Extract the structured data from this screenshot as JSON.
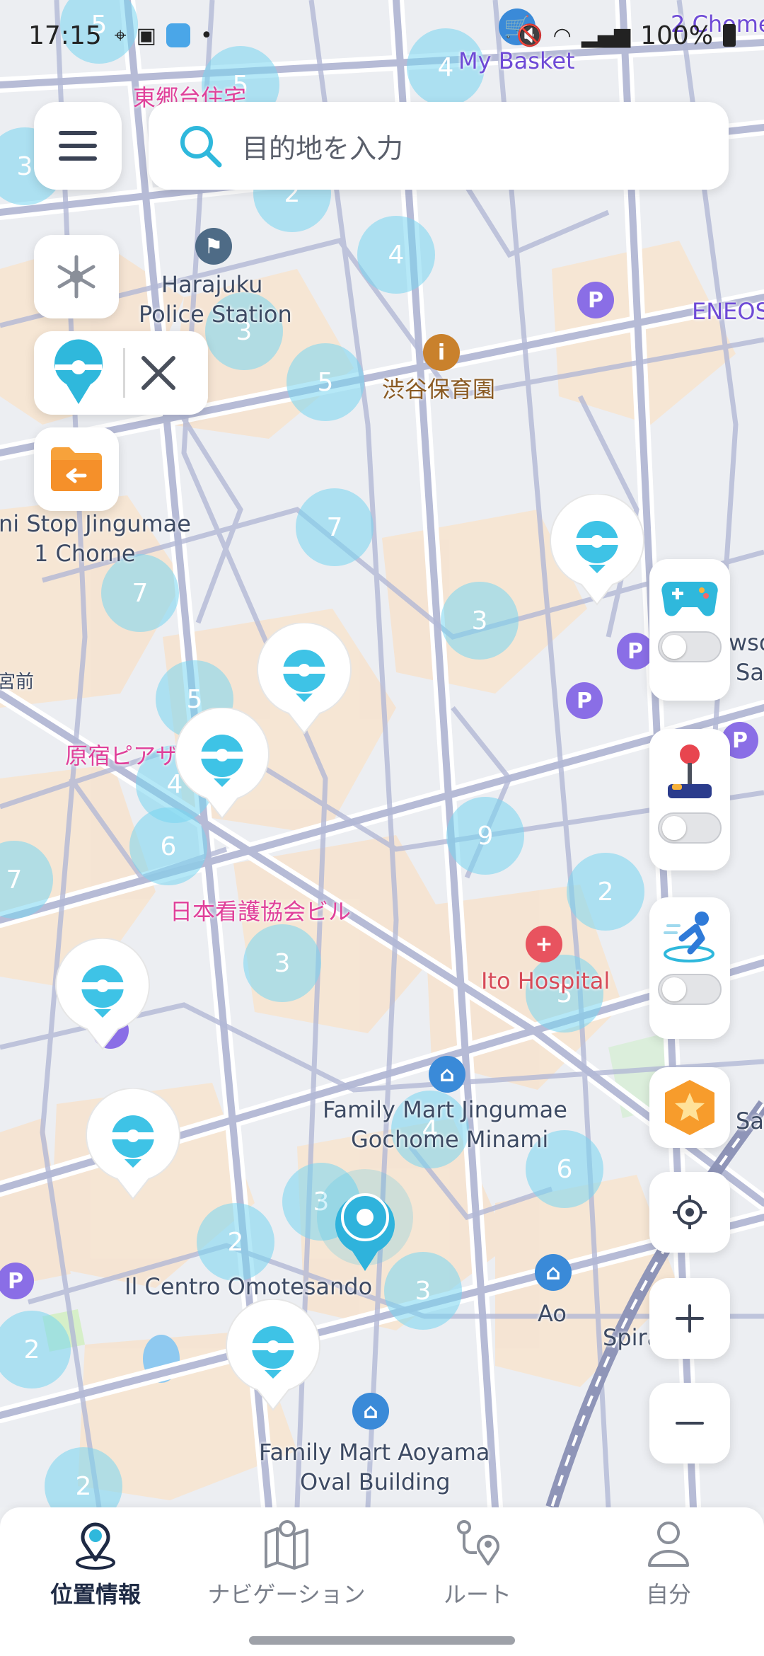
{
  "status_bar": {
    "time": "17:15",
    "battery": "100%"
  },
  "search": {
    "placeholder": "目的地を入力"
  },
  "map": {
    "labels": {
      "hongo": "東郷台住宅",
      "my_basket": "My Basket",
      "chome2": "2 Chome",
      "harajuku_police_1": "Harajuku",
      "harajuku_police_2": "Police Station",
      "eneos": "ENEOS",
      "shibuya_hoikuen": "渋谷保育園",
      "mini_stop_1": "ni Stop Jingumae",
      "mini_stop_2": "1 Chome",
      "harajuku_piazza": "原宿ピアザビル",
      "miyamae": "宮前",
      "nihon_kango": "日本看護協会ビル",
      "ito_hospital": "Ito Hospital",
      "family_mart_1a": "Family Mart Jingumae",
      "family_mart_1b": "Gochome Minami",
      "il_centro": "Il Centro Omotesando",
      "ao": "Ao",
      "spira": "Spira",
      "family_mart_2a": "Family Mart Aoyama",
      "family_mart_2b": "Oval Building",
      "east_sa": "Sa",
      "east_wso": "wso",
      "east_sa2": "Sa"
    },
    "clusters": [
      "5",
      "5",
      "4",
      "3",
      "2",
      "4",
      "3",
      "5",
      "7",
      "7",
      "3",
      "5",
      "4",
      "6",
      "9",
      "7",
      "2",
      "3",
      "5",
      "4",
      "6",
      "3",
      "2",
      "3",
      "2",
      "2"
    ]
  },
  "controls": {
    "joystick_toggle": false,
    "gamepad_toggle": false,
    "auto_walk_toggle": false
  },
  "bottom_nav": {
    "location": "位置情報",
    "navigation": "ナビゲーション",
    "route": "ルート",
    "me": "自分"
  }
}
